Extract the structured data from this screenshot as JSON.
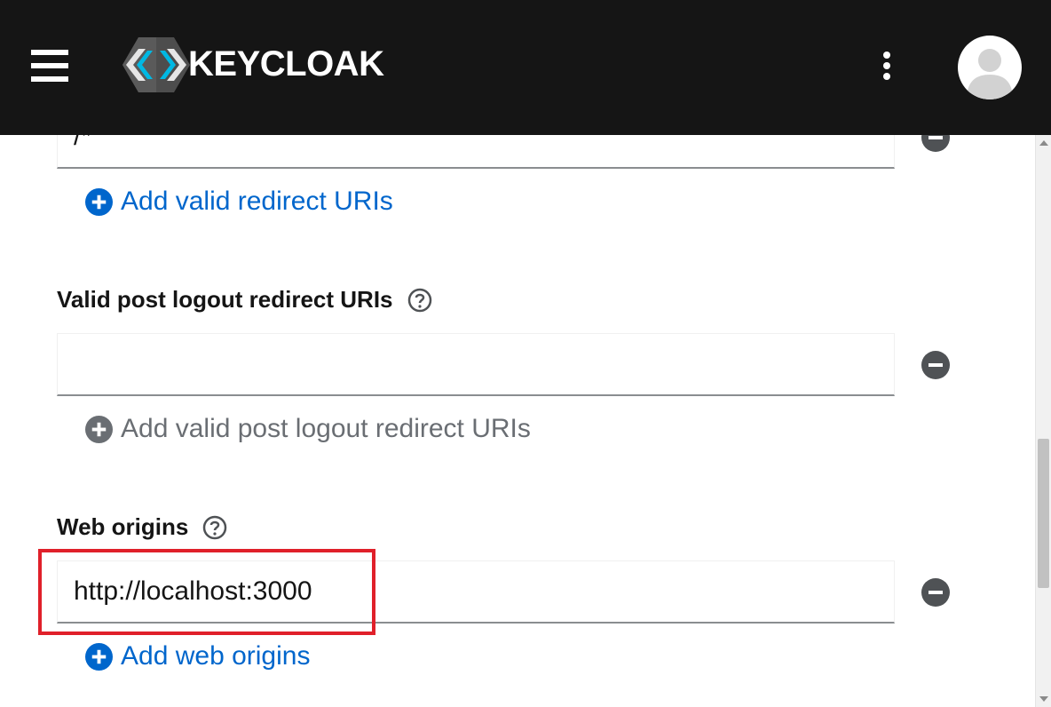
{
  "header": {
    "logo_text": "KEYCLOAK",
    "menu_icon": "hamburger-menu-icon",
    "kebab_icon": "kebab-menu-icon",
    "avatar_icon": "user-avatar-icon",
    "background": "#151515"
  },
  "redirect_uris": {
    "value": "/*",
    "add_label": "Add valid redirect URIs"
  },
  "post_logout": {
    "label": "Valid post logout redirect URIs",
    "value": "",
    "add_label": "Add valid post logout redirect URIs"
  },
  "web_origins": {
    "label": "Web origins",
    "value": "http://localhost:3000",
    "add_label": "Add web origins"
  },
  "colors": {
    "link_blue": "#0066cc",
    "disabled_grey": "#6a6e73",
    "remove_icon": "#4f5255",
    "highlight_red": "#e0202a"
  }
}
